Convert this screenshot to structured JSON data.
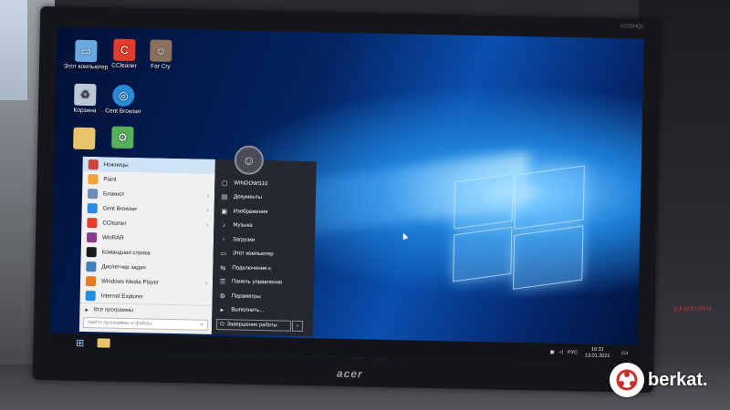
{
  "desktop": {
    "icons": [
      {
        "label": "Этот компьютер",
        "icon": "computer-icon",
        "color": "#6aa9e0"
      },
      {
        "label": "CCleaner",
        "icon": "ccleaner-icon",
        "color": "#e23c2c"
      },
      {
        "label": "Far Cry",
        "icon": "farcry-icon",
        "color": "#8a6f5a"
      },
      {
        "label": "Корзина",
        "icon": "recycle-bin-icon",
        "color": "#b9c7d6"
      },
      {
        "label": "Cent Browser",
        "icon": "cent-browser-icon",
        "color": "#2a8ad6"
      },
      {
        "label": "",
        "icon": "folder-icon",
        "color": "#e8c36a"
      },
      {
        "label": "",
        "icon": "app-icon",
        "color": "#58b05a"
      }
    ]
  },
  "start_menu": {
    "programs": [
      {
        "label": "Ножницы",
        "icon": "scissors-icon",
        "color": "#c9443b",
        "arrow": ""
      },
      {
        "label": "Paint",
        "icon": "paint-icon",
        "color": "#f2a23a",
        "arrow": ""
      },
      {
        "label": "Блокнот",
        "icon": "notepad-icon",
        "color": "#6a8fb3",
        "arrow": "›"
      },
      {
        "label": "Cent Browser",
        "icon": "cent-browser-icon",
        "color": "#2a8ad6",
        "arrow": "›"
      },
      {
        "label": "CCleaner",
        "icon": "ccleaner-icon",
        "color": "#e23c2c",
        "arrow": "›"
      },
      {
        "label": "WinRAR",
        "icon": "winrar-icon",
        "color": "#8b3a8b",
        "arrow": ""
      },
      {
        "label": "Командная строка",
        "icon": "cmd-icon",
        "color": "#1b1b1b",
        "arrow": ""
      },
      {
        "label": "Диспетчер задач",
        "icon": "task-manager-icon",
        "color": "#3f7fbf",
        "arrow": ""
      },
      {
        "label": "Windows Media Player",
        "icon": "media-player-icon",
        "color": "#e97a1f",
        "arrow": "›"
      },
      {
        "label": "Internet Explorer",
        "icon": "ie-icon",
        "color": "#1f8de0",
        "arrow": ""
      }
    ],
    "all_programs": "Все программы",
    "search_placeholder": "Найти программы и файлы",
    "places": [
      {
        "label": "WINDOWS10",
        "icon": "user-folder-icon",
        "glyph": "▢"
      },
      {
        "label": "Документы",
        "icon": "documents-icon",
        "glyph": "▤"
      },
      {
        "label": "Изображения",
        "icon": "pictures-icon",
        "glyph": "▣"
      },
      {
        "label": "Музыка",
        "icon": "music-icon",
        "glyph": "♪"
      },
      {
        "label": "Загрузки",
        "icon": "downloads-icon",
        "glyph": "↓"
      },
      {
        "label": "Этот компьютер",
        "icon": "computer-icon",
        "glyph": "▭"
      },
      {
        "label": "Подключение к",
        "icon": "network-icon",
        "glyph": "⇆"
      },
      {
        "label": "Панель управления",
        "icon": "control-panel-icon",
        "glyph": "☰"
      },
      {
        "label": "Параметры",
        "icon": "settings-icon",
        "glyph": "⚙"
      },
      {
        "label": "Выполнить...",
        "icon": "run-icon",
        "glyph": "▸"
      }
    ],
    "shutdown_label": "Завершение работы",
    "shutdown_glyph": "⏻",
    "shutdown_arrow": "›"
  },
  "taskbar": {
    "language": "РУС",
    "time": "16:31",
    "date": "13.01.2021"
  },
  "monitor": {
    "brand": "acer",
    "corner_label": "V226HQL"
  },
  "right_device_label": "SAMSUNG",
  "watermark": {
    "text": "berkat."
  }
}
